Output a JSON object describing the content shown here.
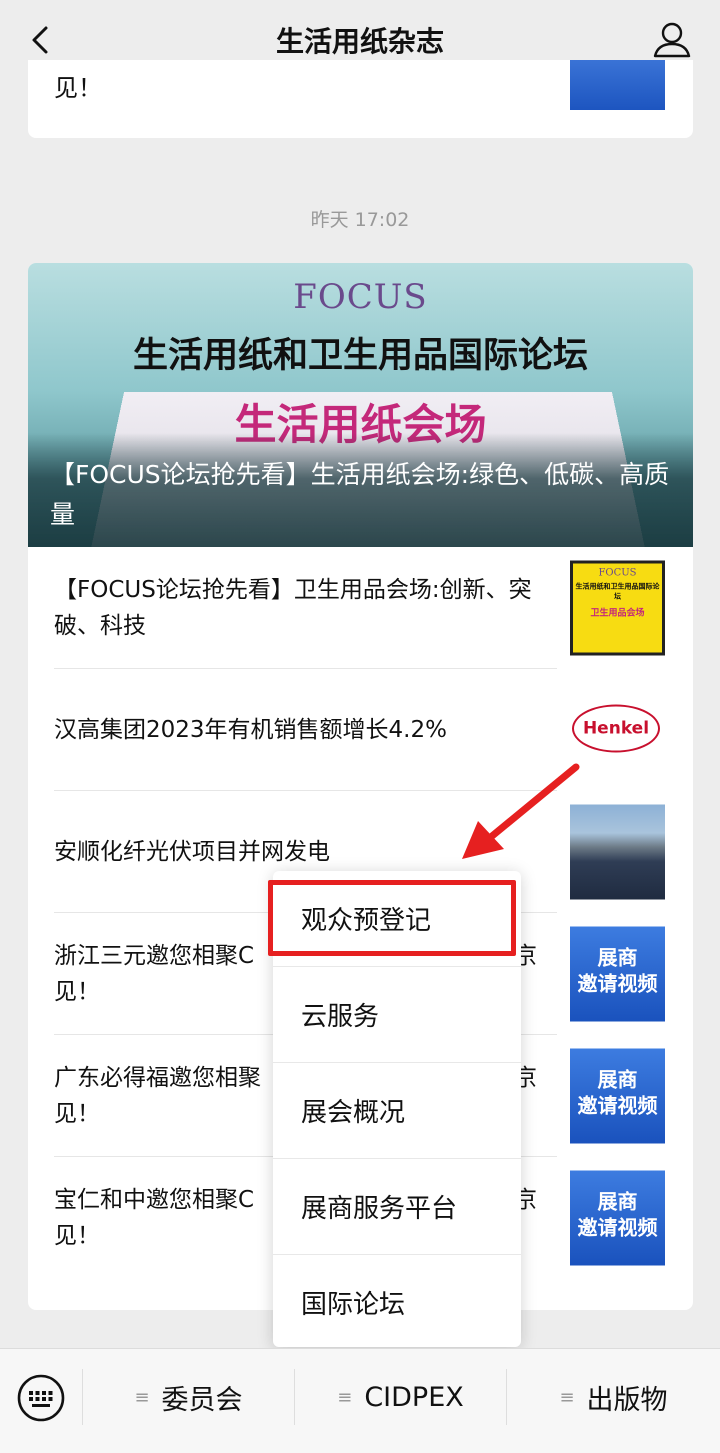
{
  "header": {
    "title": "生活用纸杂志"
  },
  "top_card": {
    "text": "见！"
  },
  "timestamp": "昨天 17:02",
  "main_article": {
    "banner_logo": "FOCUS",
    "banner_headline": "生活用纸和卫生用品国际论坛",
    "banner_subhead": "生活用纸会场",
    "caption": "【FOCUS论坛抢先看】生活用纸会场:绿色、低碳、高质量"
  },
  "articles": [
    {
      "title": "【FOCUS论坛抢先看】卫生用品会场:创新、突破、科技",
      "thumb_line1": "FOCUS",
      "thumb_line2": "生活用纸和卫生用品国际论坛",
      "thumb_line3": "卫生用品会场"
    },
    {
      "title": "汉高集团2023年有机销售额增长4.2%",
      "thumb_logo": "Henkel"
    },
    {
      "title": "安顺化纤光伏项目并网发电"
    },
    {
      "title": "浙江三元邀您相聚C",
      "title_tail": "京",
      "title_line2": "见！",
      "thumb_text": "展商\n邀请视频"
    },
    {
      "title": "广东必得福邀您相聚",
      "title_tail": "京",
      "title_line2": "见！",
      "thumb_text": "展商\n邀请视频"
    },
    {
      "title": "宝仁和中邀您相聚C",
      "title_tail": "京",
      "title_line2": "见！",
      "thumb_text": "展商\n邀请视频"
    }
  ],
  "popup_menu": {
    "items": [
      "观众预登记",
      "云服务",
      "展会概况",
      "展商服务平台",
      "国际论坛"
    ],
    "highlight_color": "#e62020"
  },
  "bottom_bar": {
    "tabs": [
      "委员会",
      "CIDPEX",
      "出版物"
    ]
  }
}
